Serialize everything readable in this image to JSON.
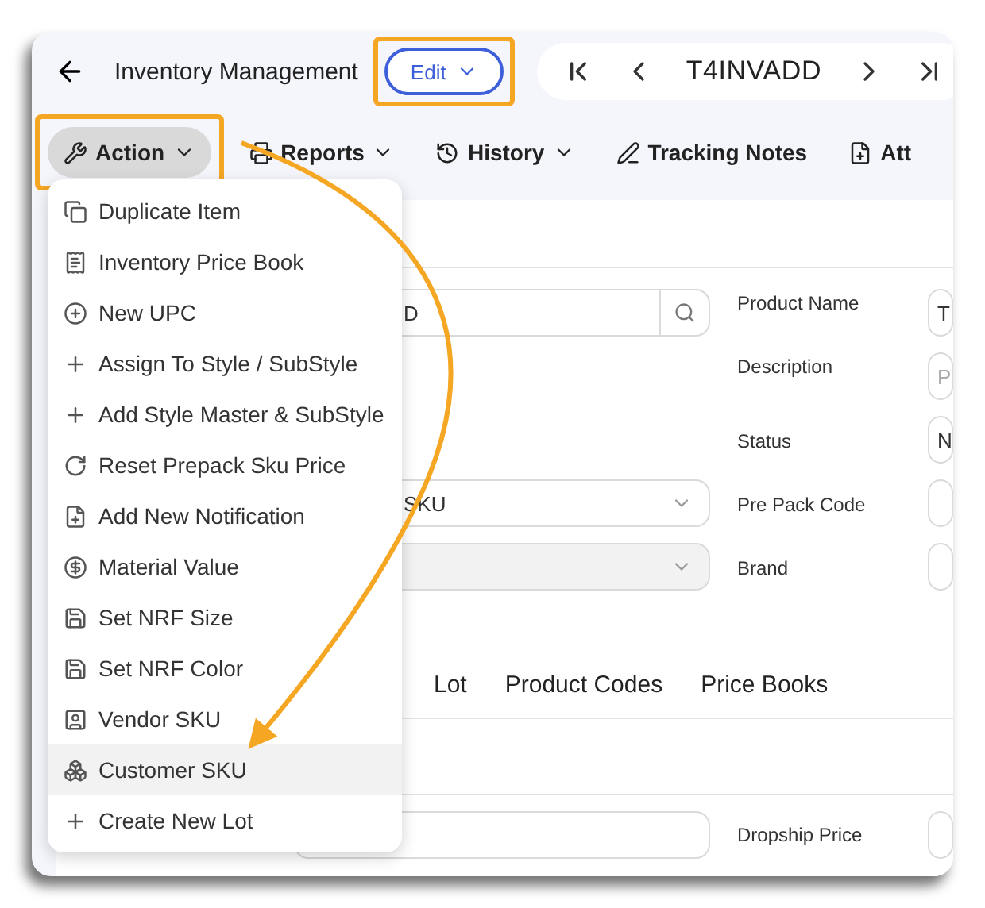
{
  "header": {
    "title": "Inventory Management",
    "edit_button": {
      "label": "Edit",
      "highlighted": true
    },
    "record": "T4INVADD"
  },
  "toolbar": [
    {
      "label": "Action",
      "selected": true,
      "highlighted": true,
      "has_menu": true
    },
    {
      "label": "Reports",
      "selected": false,
      "highlighted": false,
      "has_menu": true
    },
    {
      "label": "History",
      "selected": false,
      "highlighted": false,
      "has_menu": true
    },
    {
      "label": "Tracking Notes",
      "selected": false,
      "highlighted": false,
      "has_menu": false
    },
    {
      "label": "Att",
      "selected": false,
      "highlighted": false,
      "has_menu": false
    }
  ],
  "form": {
    "rows": [
      {
        "left": {
          "kind": "search",
          "value": "D"
        },
        "label": "Product Name",
        "right": {
          "value": "T"
        }
      },
      {
        "label": "Description",
        "right": {
          "placeholder": "P"
        }
      },
      {
        "label": "Status",
        "right": {
          "value": "N"
        }
      },
      {
        "left": {
          "kind": "select",
          "value": "SKU",
          "disabled": false
        },
        "label": "Pre Pack Code",
        "right": {}
      },
      {
        "left": {
          "kind": "select",
          "disabled": true
        },
        "label": "Brand",
        "right": {}
      }
    ]
  },
  "tabs": [
    {
      "label": "Lot",
      "selected": false
    },
    {
      "label": "Product Codes",
      "selected": false
    },
    {
      "label": "Price Books",
      "selected": false
    }
  ],
  "bottom_row": {
    "label": "Dropship Price"
  },
  "action_menu": [
    {
      "label": "Duplicate Item",
      "selected": false
    },
    {
      "label": "Inventory Price Book",
      "selected": false
    },
    {
      "label": "New UPC",
      "selected": false
    },
    {
      "label": "Assign To Style / SubStyle",
      "selected": false
    },
    {
      "label": "Add Style Master & SubStyle",
      "selected": false
    },
    {
      "label": "Reset Prepack Sku Price",
      "selected": false
    },
    {
      "label": "Add New Notification",
      "selected": false
    },
    {
      "label": "Material Value",
      "selected": false
    },
    {
      "label": "Set NRF Size",
      "selected": false
    },
    {
      "label": "Set NRF Color",
      "selected": false
    },
    {
      "label": "Vendor SKU",
      "selected": false
    },
    {
      "label": "Customer SKU",
      "selected": true
    },
    {
      "label": "Create New Lot",
      "selected": false
    }
  ]
}
